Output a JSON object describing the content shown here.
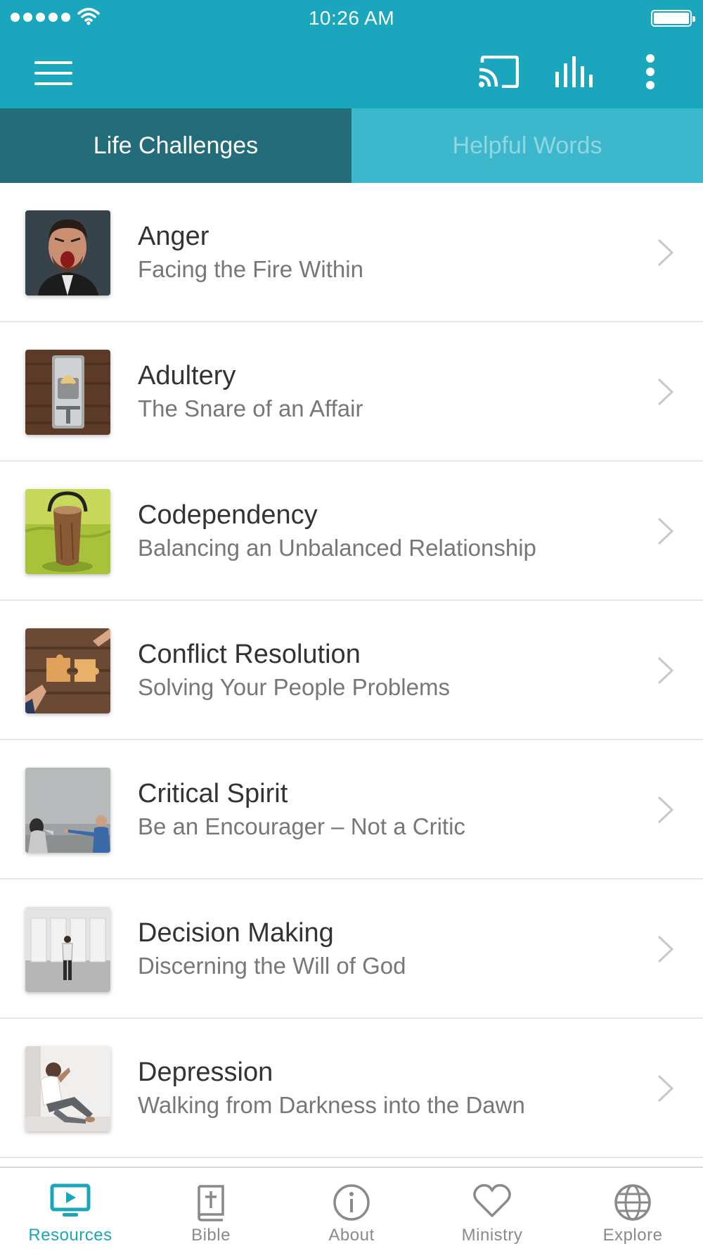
{
  "status_bar": {
    "time": "10:26 AM"
  },
  "toolbar": {
    "menu_icon": "hamburger-menu-icon",
    "cast_icon": "cast-icon",
    "equalizer_icon": "equalizer-icon",
    "more_icon": "more-vertical-icon"
  },
  "tabs": [
    {
      "label": "Life Challenges",
      "active": true
    },
    {
      "label": "Helpful Words",
      "active": false
    }
  ],
  "topics": [
    {
      "title": "Anger",
      "subtitle": "Facing the Fire Within",
      "image": "screaming-man-photo"
    },
    {
      "title": "Adultery",
      "subtitle": "The Snare of an Affair",
      "image": "mousetrap-photo"
    },
    {
      "title": "Codependency",
      "subtitle": "Balancing an Unbalanced Relationship",
      "image": "log-on-grass-photo"
    },
    {
      "title": "Conflict Resolution",
      "subtitle": "Solving Your People Problems",
      "image": "puzzle-pieces-photo"
    },
    {
      "title": "Critical Spirit",
      "subtitle": "Be an Encourager – Not a Critic",
      "image": "pointing-men-photo"
    },
    {
      "title": "Decision Making",
      "subtitle": "Discerning the Will of God",
      "image": "man-facing-doors-photo"
    },
    {
      "title": "Depression",
      "subtitle": "Walking from Darkness into the Dawn",
      "image": "sad-man-photo"
    }
  ],
  "bottom_nav": [
    {
      "label": "Resources",
      "icon": "tv-play-icon",
      "active": true
    },
    {
      "label": "Bible",
      "icon": "bible-icon",
      "active": false
    },
    {
      "label": "About",
      "icon": "info-icon",
      "active": false
    },
    {
      "label": "Ministry",
      "icon": "heart-icon",
      "active": false
    },
    {
      "label": "Explore",
      "icon": "globe-icon",
      "active": false
    }
  ],
  "colors": {
    "primary": "#1aa6bd",
    "tab_active": "#236d7a",
    "tab_inactive": "#3cb7cb",
    "nav_inactive": "#8a8a8a"
  }
}
